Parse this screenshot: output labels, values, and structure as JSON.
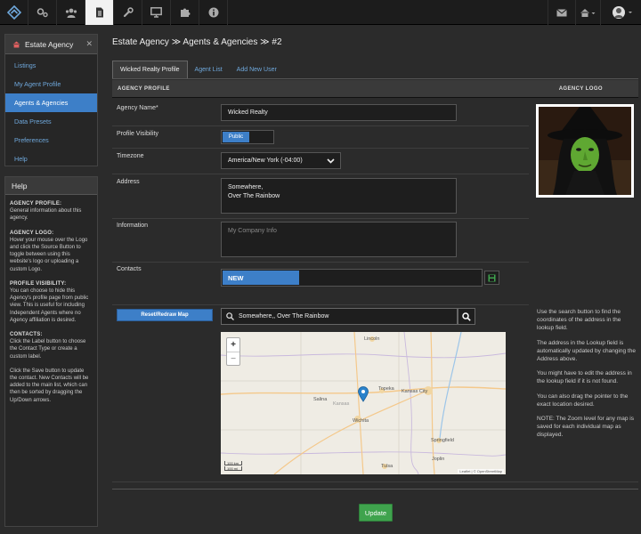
{
  "nav": {
    "icons": [
      "brand-logo-icon",
      "cogs-icon",
      "users-icon",
      "document-icon",
      "wrench-icon",
      "monitor-icon",
      "puzzle-icon",
      "info-icon",
      "mail-icon",
      "home-icon",
      "user-avatar-icon"
    ],
    "active_color": "#f2f2f2"
  },
  "sidebar": {
    "title": "Estate Agency",
    "items": [
      {
        "label": "Listings"
      },
      {
        "label": "My Agent Profile"
      },
      {
        "label": "Agents & Agencies",
        "active": true
      },
      {
        "label": "Data Presets"
      },
      {
        "label": "Preferences"
      },
      {
        "label": "Help"
      }
    ]
  },
  "help": {
    "title": "Help",
    "sections": [
      {
        "heading": "AGENCY PROFILE:",
        "text": "General information about this agency."
      },
      {
        "heading": "AGENCY LOGO:",
        "text": "Hover your mouse over the Logo and click the Source Button to toggle between using this website's logo or uploading a custom Logo."
      },
      {
        "heading": "PROFILE VISIBILITY:",
        "text": "You can choose to hide this Agency's profile page from public view. This is useful for including Independent Agents where no Agency affiliation is desired."
      },
      {
        "heading": "CONTACTS:",
        "text": "Click the Label button to choose the Contact Type or create a custom label."
      },
      {
        "heading": "",
        "text": "Click the Save button to update the contact. New Contacts will be added to the main list, which can then be sorted by dragging the Up/Down arrows."
      }
    ]
  },
  "breadcrumb": {
    "part1": "Estate Agency",
    "part2": "Agents & Agencies",
    "part3": "#2",
    "sep": "≫"
  },
  "tabs": [
    {
      "label": "Wicked Realty Profile",
      "active": true
    },
    {
      "label": "Agent List"
    },
    {
      "label": "Add New User"
    }
  ],
  "section": {
    "left": "AGENCY PROFILE",
    "right": "AGENCY LOGO"
  },
  "form": {
    "agency_name_label": "Agency Name*",
    "agency_name_value": "Wicked Realty",
    "visibility_label": "Profile Visibility",
    "visibility_value": "Public",
    "timezone_label": "Timezone",
    "timezone_value": "America/New York (-04:00)",
    "address_label": "Address",
    "address_line1": "Somewhere,",
    "address_line2": "Over The Rainbow",
    "information_label": "Information",
    "information_placeholder": "My Company Info",
    "contacts_label": "Contacts",
    "contacts_new": "NEW"
  },
  "map": {
    "reset_label": "Reset/Redraw Map",
    "lookup_value": "Somewhere,, Over The Rainbow",
    "labels": [
      "Lincoln",
      "Topeka",
      "Kansas City",
      "Salina",
      "Kansas",
      "Wichita",
      "Springfield",
      "Joplin",
      "Tulsa"
    ],
    "scale_top": "100 km",
    "scale_bottom": "100 mi",
    "attribution": "Leaflet | © OpenStreetMap"
  },
  "map_help": [
    "Use the search button to find the coordinates of the address in the lookup field.",
    "The address in the Lookup field is automatically updated by changing the Address above.",
    "You might have to edit the address in the lookup field if it is not found.",
    "You can also drag the pointer to the exact location desired.",
    "NOTE: The Zoom level for any map is saved for each individual map as displayed."
  ],
  "actions": {
    "update_label": "Update"
  },
  "colors": {
    "accent": "#3d7fc8",
    "link": "#6fa8dc",
    "success": "#3fa34d",
    "bg": "#2b2b2b"
  }
}
